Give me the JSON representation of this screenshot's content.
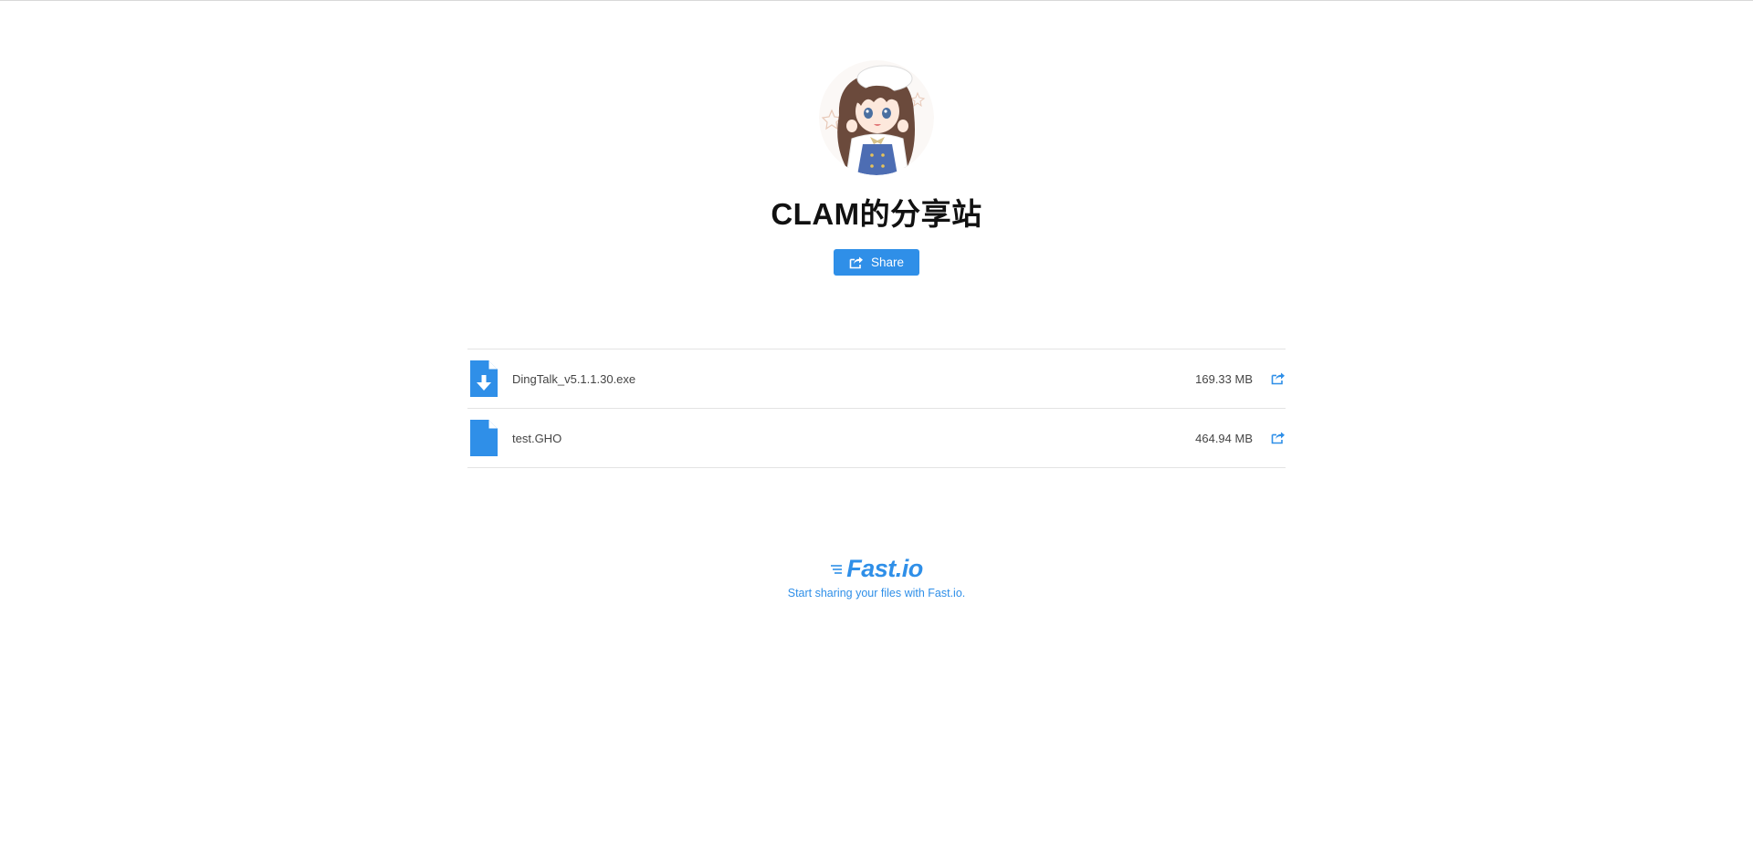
{
  "site": {
    "title": "CLAM的分享站",
    "avatar_alt": "avatar"
  },
  "share_button": {
    "label": "Share",
    "icon": "share-icon"
  },
  "files": [
    {
      "name": "DingTalk_v5.1.1.30.exe",
      "size": "169.33 MB",
      "icon": "file-download-icon"
    },
    {
      "name": "test.GHO",
      "size": "464.94 MB",
      "icon": "file-icon"
    }
  ],
  "footer": {
    "brand": "Fast.io",
    "tagline": "Start sharing your files with Fast.io."
  },
  "colors": {
    "accent": "#2f8fe8",
    "title": "#111111",
    "text": "#444444",
    "divider": "#e3e3e3"
  }
}
